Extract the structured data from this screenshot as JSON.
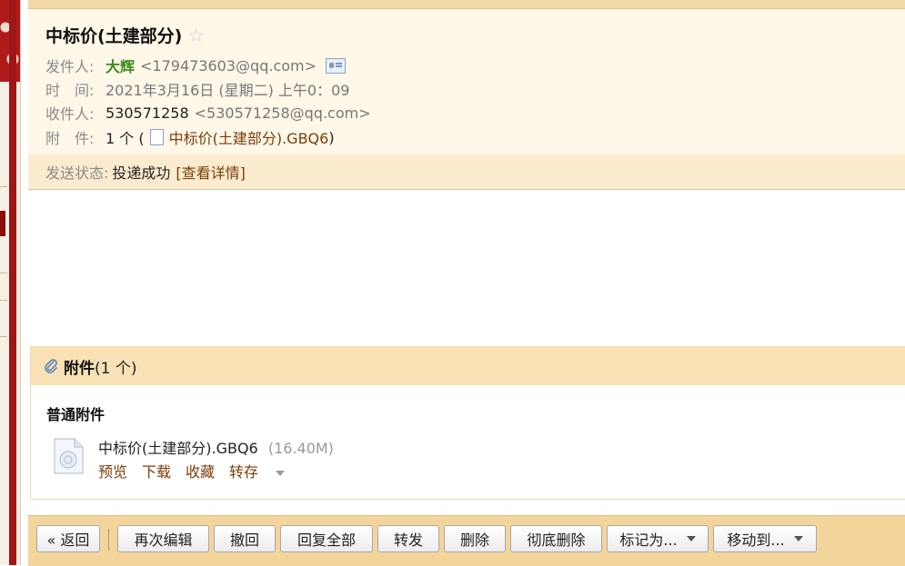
{
  "email": {
    "subject": "中标价(土建部分)",
    "sender_label": "发件人:",
    "sender_name": "大辉",
    "sender_email": "<179473603@qq.com>",
    "time_label": "时　间:",
    "time_value": "2021年3月16日 (星期二) 上午0：09",
    "recipient_label": "收件人:",
    "recipient_name": "530571258",
    "recipient_email": "<530571258@qq.com>",
    "attachment_label": "附　件:",
    "attachment_count": "1 个 (",
    "attachment_link": "中标价(土建部分).GBQ6",
    "attachment_close": ")"
  },
  "status": {
    "label": "发送状态:",
    "value": "投递成功",
    "detail": "[查看详情]"
  },
  "attachments": {
    "title": "附件",
    "count": "(1 个)",
    "section": "普通附件",
    "file_name": "中标价(土建部分).GBQ6",
    "file_size": "(16.40M)",
    "actions": {
      "preview": "预览",
      "download": "下载",
      "favorite": "收藏",
      "save_to": "转存"
    }
  },
  "toolbar": {
    "back": "« 返回",
    "reedit": "再次编辑",
    "recall": "撤回",
    "reply_all": "回复全部",
    "forward": "转发",
    "delete": "删除",
    "delete_permanently": "彻底删除",
    "mark_as": "标记为...",
    "move_to": "移动到..."
  }
}
